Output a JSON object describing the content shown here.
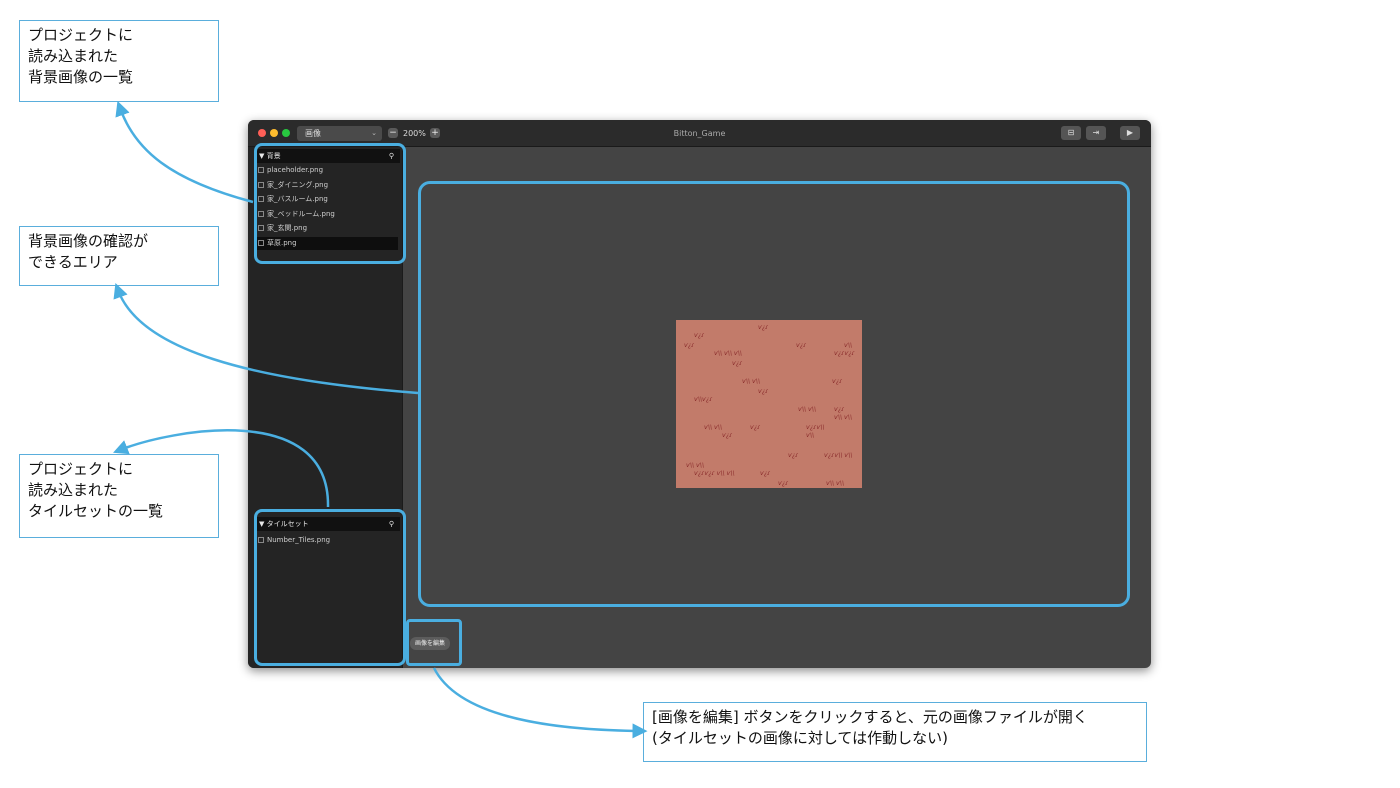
{
  "annotations": {
    "background_list": "プロジェクトに\n読み込まれた\n背景画像の一覧",
    "preview_area": "背景画像の確認が\nできるエリア",
    "tileset_list": "プロジェクトに\n読み込まれた\nタイルセットの一覧",
    "edit_button": "[画像を編集] ボタンをクリックすると、元の画像ファイルが開く\n(タイルセットの画像に対しては作動しない)"
  },
  "window": {
    "title": "Bitton_Game",
    "mode_select": "画像",
    "mode_chevron": "⌄",
    "zoom_minus": "−",
    "zoom_level": "200%",
    "zoom_plus": "+",
    "toolbar_folder": "⊟",
    "toolbar_export": "⇥",
    "toolbar_play": "▶"
  },
  "sidebar": {
    "background_panel": {
      "title": "▼ 背景",
      "search": "⚲",
      "items": [
        "placeholder.png",
        "家_ダイニング.png",
        "家_バスルーム.png",
        "家_ベッドルーム.png",
        "家_玄関.png",
        "草原.png"
      ],
      "selected_index": 5
    },
    "tileset_panel": {
      "title": "▼ タイルセット",
      "search": "⚲",
      "items": [
        "Number_Tiles.png"
      ]
    }
  },
  "main": {
    "edit_button_label": "画像を編集"
  },
  "colors": {
    "accent": "#4aaee0",
    "window_bg": "#444444",
    "sidebar_bg": "#242424",
    "preview_bg": "#c27b6a",
    "grass": "#8a2c2c"
  }
}
